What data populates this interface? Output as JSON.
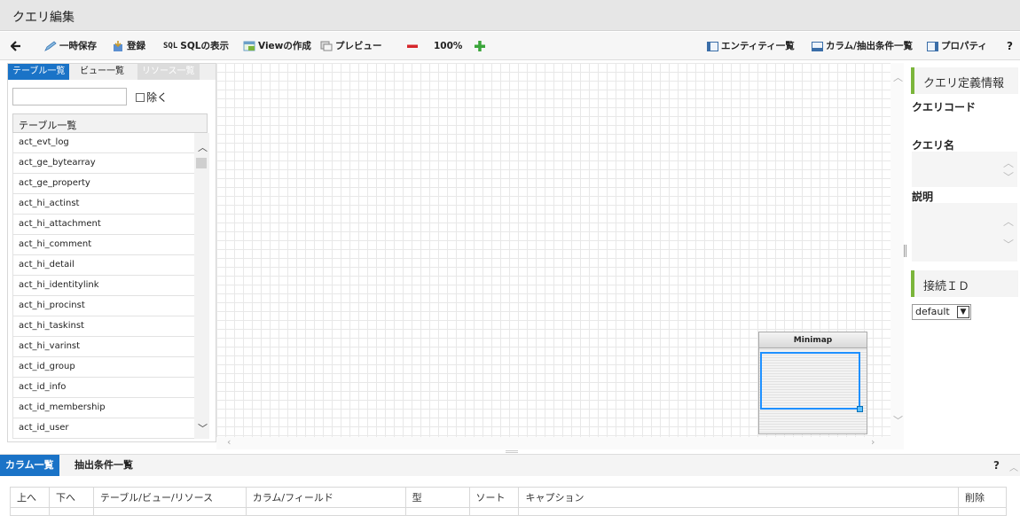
{
  "window": {
    "title": "クエリ編集"
  },
  "toolbar": {
    "back_icon": "arrow-left-icon",
    "temp_save": "一時保存",
    "register": "登録",
    "sql_prefix": "SQL",
    "sql_show": "SQLの表示",
    "view_create": "Viewの作成",
    "preview": "プレビュー",
    "zoom": "100%",
    "entity_list": "エンティティ一覧",
    "column_list": "カラム/抽出条件一覧",
    "property": "プロパティ",
    "help": "?"
  },
  "left": {
    "tabs": [
      "テーブル一覧",
      "ビュー一覧",
      "リソース一覧"
    ],
    "filter_value": "",
    "exclude_label": "除く",
    "list_header": "テーブル一覧",
    "tables": [
      "act_evt_log",
      "act_ge_bytearray",
      "act_ge_property",
      "act_hi_actinst",
      "act_hi_attachment",
      "act_hi_comment",
      "act_hi_detail",
      "act_hi_identitylink",
      "act_hi_procinst",
      "act_hi_taskinst",
      "act_hi_varinst",
      "act_id_group",
      "act_id_info",
      "act_id_membership",
      "act_id_user"
    ]
  },
  "minimap": {
    "title": "Minimap"
  },
  "right": {
    "section_query": "クエリ定義情報",
    "query_code_label": "クエリコード",
    "query_name_label": "クエリ名",
    "description_label": "説明",
    "section_connection": "接続ＩＤ",
    "connection_value": "default"
  },
  "bottom": {
    "tabs": [
      "カラム一覧",
      "抽出条件一覧"
    ],
    "help": "?",
    "columns": [
      "上へ",
      "下へ",
      "テーブル/ビュー/リソース",
      "カラム/フィールド",
      "型",
      "ソート",
      "キャプション",
      "削除"
    ]
  },
  "colors": {
    "accent": "#1a73c7",
    "section_bar": "#7bb53b",
    "minimap_view": "#1e90ff"
  }
}
